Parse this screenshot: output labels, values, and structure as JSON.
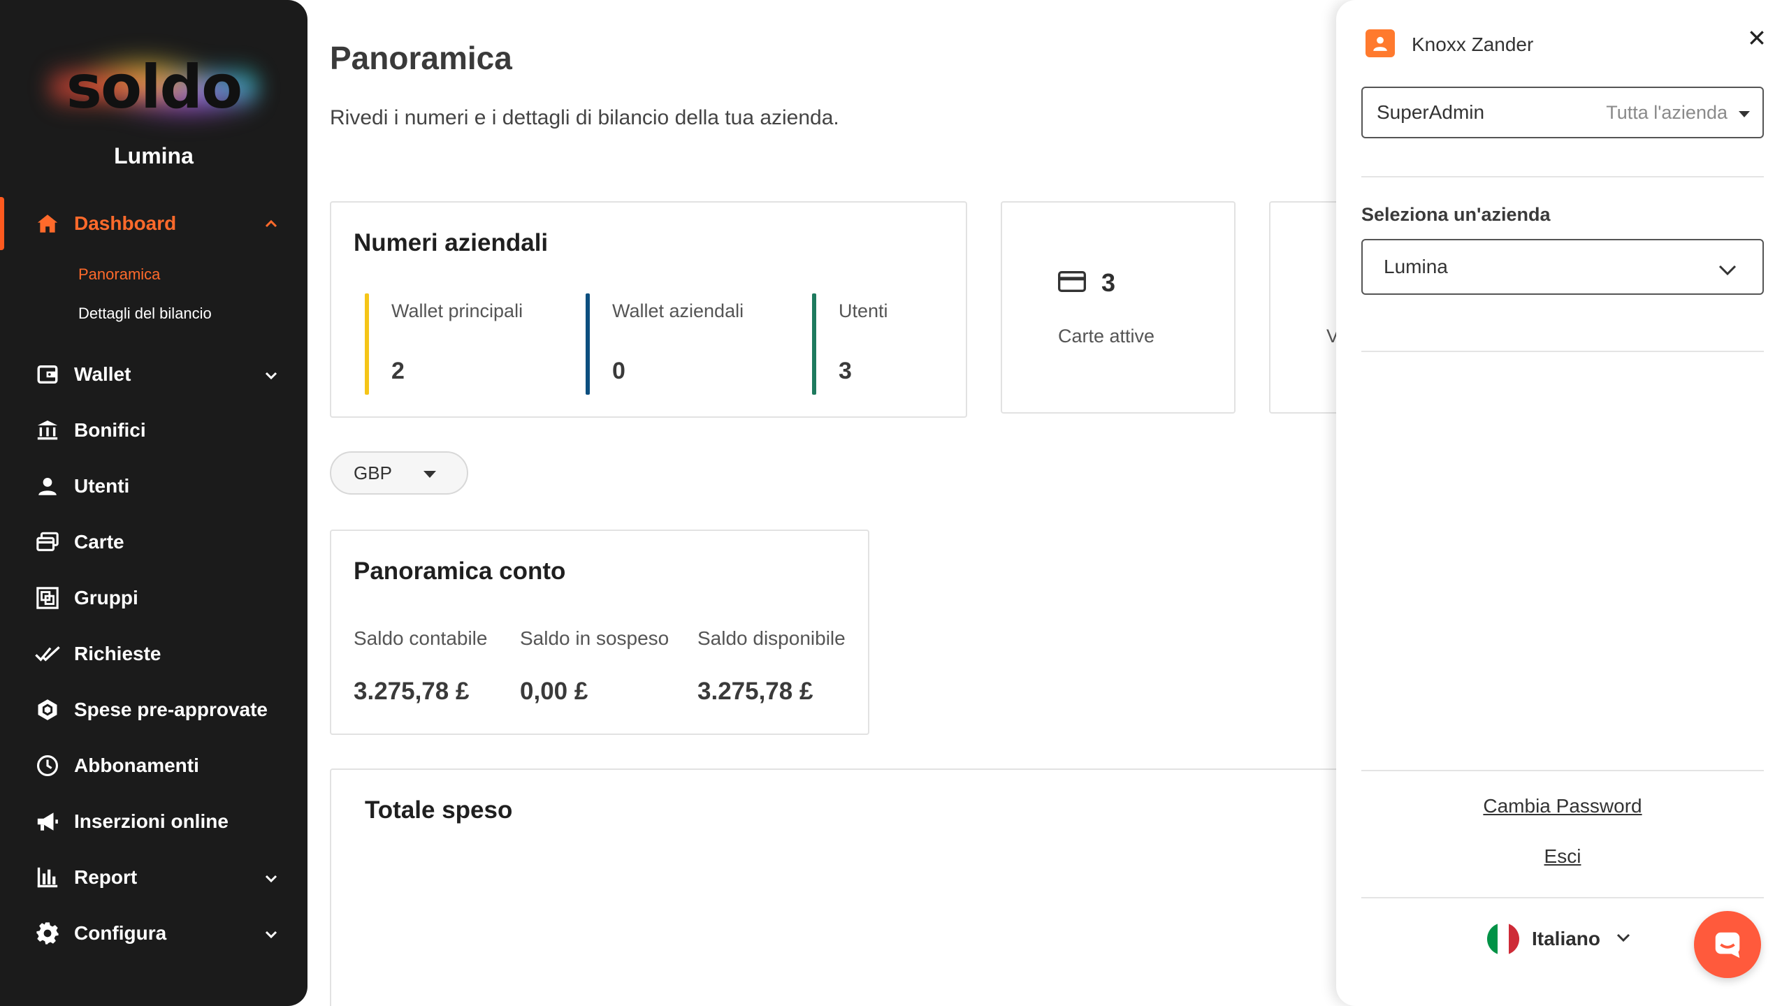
{
  "sidebar": {
    "logo": "soldo",
    "company": "Lumina",
    "nav": [
      {
        "label": "Dashboard",
        "icon": "home-icon",
        "active": true,
        "expanded": true
      },
      {
        "label": "Wallet",
        "icon": "wallet-icon",
        "has_chevron": true
      },
      {
        "label": "Bonifici",
        "icon": "bank-transfer-icon"
      },
      {
        "label": "Utenti",
        "icon": "user-icon"
      },
      {
        "label": "Carte",
        "icon": "cards-icon"
      },
      {
        "label": "Gruppi",
        "icon": "groups-icon"
      },
      {
        "label": "Richieste",
        "icon": "double-check-icon"
      },
      {
        "label": "Spese pre-approvate",
        "icon": "hexagon-icon"
      },
      {
        "label": "Abbonamenti",
        "icon": "clock-icon"
      },
      {
        "label": "Inserzioni online",
        "icon": "megaphone-icon"
      },
      {
        "label": "Report",
        "icon": "bar-chart-icon",
        "has_chevron": true
      },
      {
        "label": "Configura",
        "icon": "gear-icon",
        "has_chevron": true
      }
    ],
    "sub_items": [
      {
        "label": "Panoramica",
        "active": true
      },
      {
        "label": "Dettagli del bilancio",
        "active": false
      }
    ],
    "accent_color": "#ff6a2b"
  },
  "main": {
    "title": "Panoramica",
    "subtitle": "Rivedi i numeri e i dettagli di bilancio della tua azienda.",
    "company_numbers": {
      "title": "Numeri aziendali",
      "stats": [
        {
          "label": "Wallet principali",
          "value": "2",
          "color": "#f5c518"
        },
        {
          "label": "Wallet aziendali",
          "value": "0",
          "color": "#0d4f7f"
        },
        {
          "label": "Utenti",
          "value": "3",
          "color": "#1e7a5e"
        }
      ]
    },
    "active_cards": {
      "count": "3",
      "label": "Carte attive"
    },
    "partial_card": {
      "label_initial": "V"
    },
    "currency": "GBP",
    "account_overview": {
      "title": "Panoramica conto",
      "items": [
        {
          "label": "Saldo contabile",
          "value": "3.275,78 £"
        },
        {
          "label": "Saldo in sospeso",
          "value": "0,00 £"
        },
        {
          "label": "Saldo disponibile",
          "value": "3.275,78 £"
        }
      ]
    },
    "total_spent": {
      "title": "Totale speso"
    }
  },
  "panel": {
    "user_name": "Knoxx Zander",
    "role": "SuperAdmin",
    "role_scope": "Tutta l'azienda",
    "select_company_label": "Seleziona un'azienda",
    "selected_company": "Lumina",
    "change_password": "Cambia Password",
    "logout": "Esci",
    "language": "Italiano",
    "chat_color": "#ff5a3c"
  }
}
